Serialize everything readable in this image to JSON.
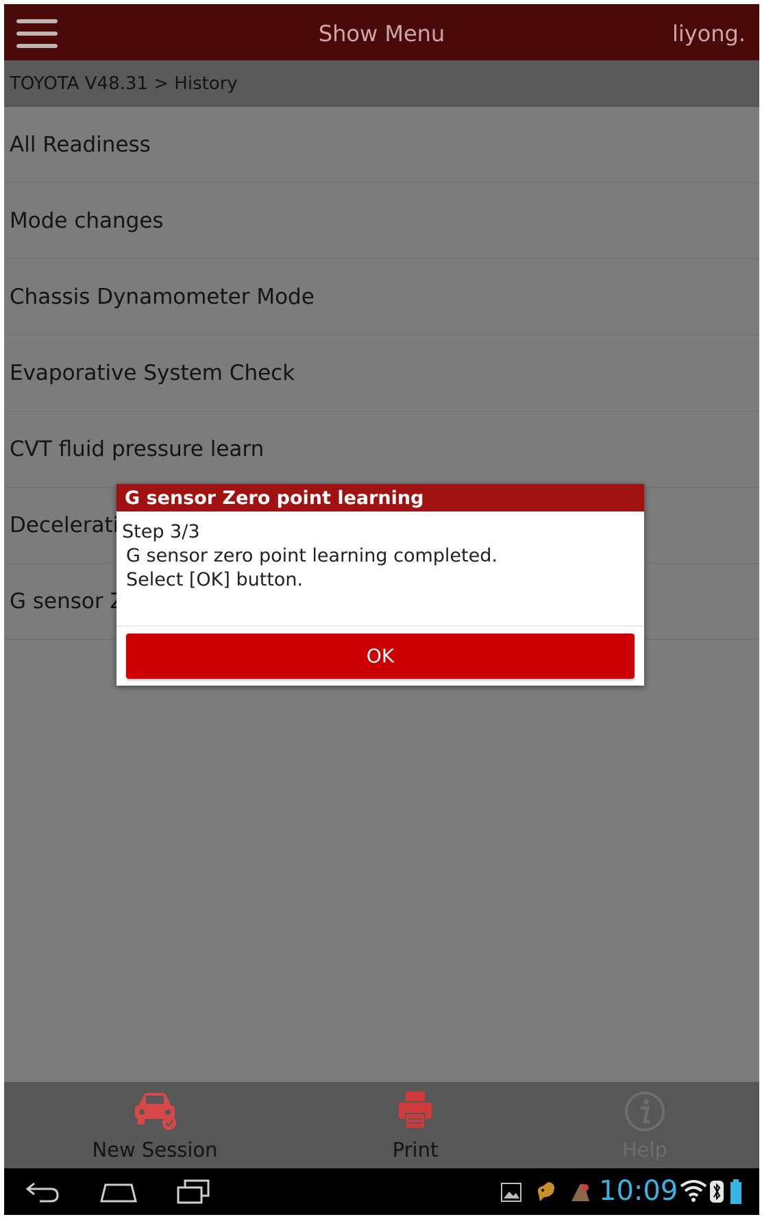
{
  "header": {
    "title": "Show Menu",
    "user": "liyong."
  },
  "breadcrumb": "TOYOTA V48.31 > History",
  "menu": {
    "items": [
      {
        "label": "All Readiness"
      },
      {
        "label": "Mode changes"
      },
      {
        "label": "Chassis Dynamometer Mode"
      },
      {
        "label": "Evaporative System Check"
      },
      {
        "label": "CVT fluid pressure learn"
      },
      {
        "label": "Deceleratic"
      },
      {
        "label": "G sensor Z"
      }
    ]
  },
  "dialog": {
    "title": "G sensor Zero point learning",
    "step": "Step 3/3",
    "line1": "G sensor zero point learning completed.",
    "line2": "Select [OK] button.",
    "ok_label": "OK"
  },
  "toolbar": {
    "new_session": "New Session",
    "print": "Print",
    "help": "Help"
  },
  "status": {
    "time": "10:09"
  },
  "colors": {
    "header_bg": "#4a0a0a",
    "dialog_header": "#a01212",
    "ok_button": "#cc0000",
    "clock": "#36b5e5",
    "new_session_icon": "#d94848",
    "print_icon": "#d13a3a"
  }
}
